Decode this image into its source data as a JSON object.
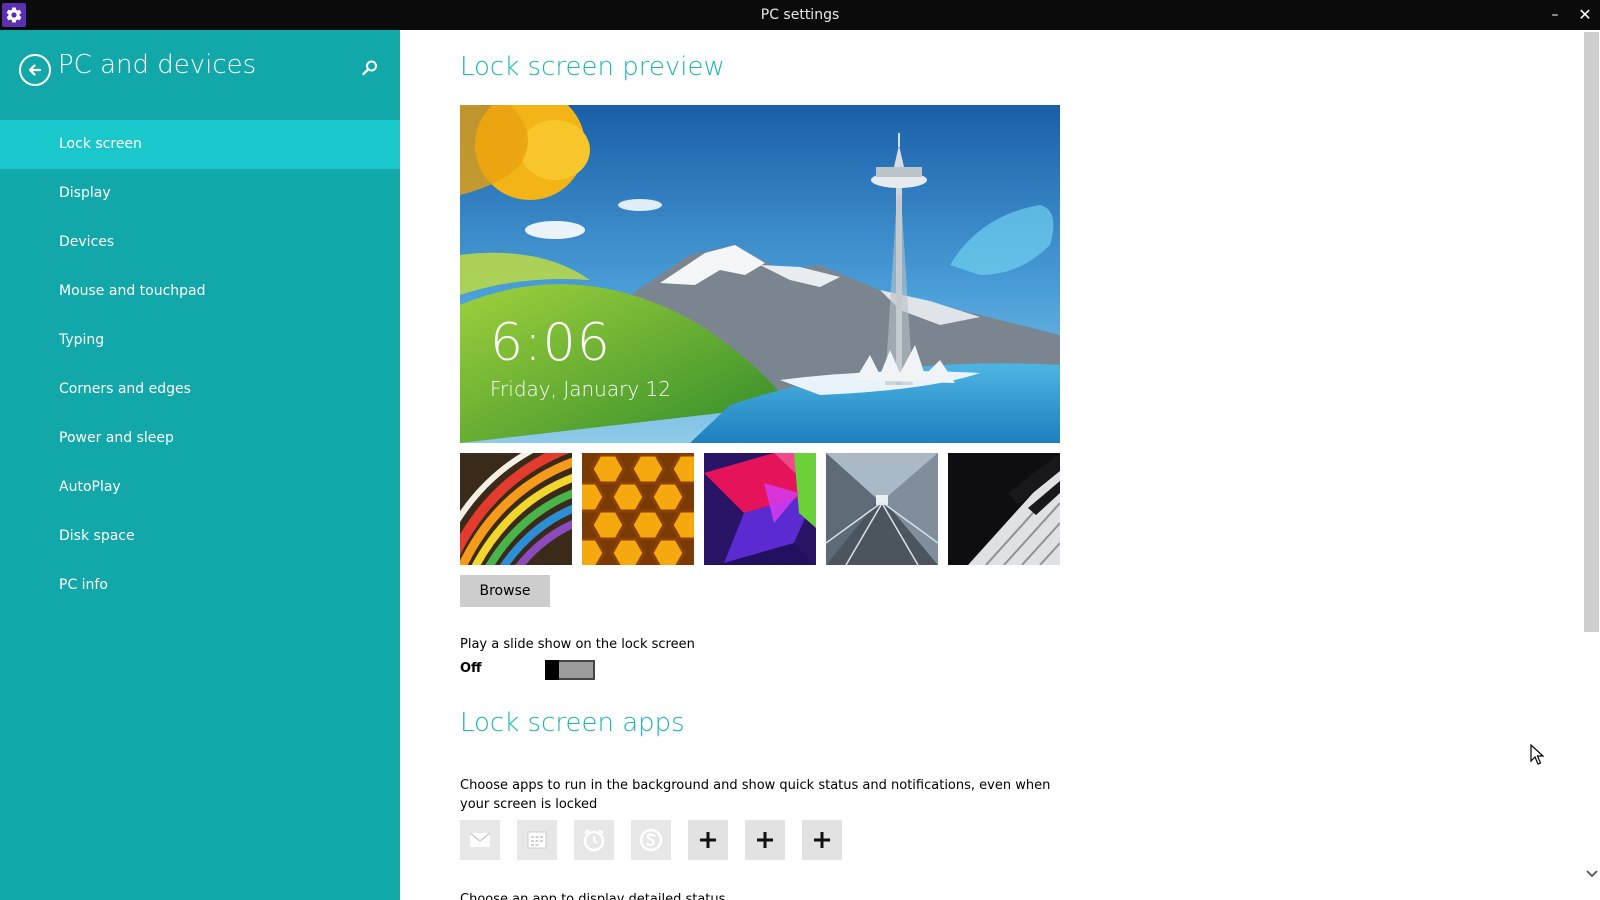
{
  "window": {
    "title": "PC settings",
    "minimize_glyph": "–",
    "close_glyph": "✕",
    "app_icon": "gear-icon"
  },
  "sidebar": {
    "title": "PC and devices",
    "back_icon": "back-arrow-icon",
    "search_icon": "search-icon",
    "items": [
      {
        "label": "Lock screen",
        "active": true
      },
      {
        "label": "Display"
      },
      {
        "label": "Devices"
      },
      {
        "label": "Mouse and touchpad"
      },
      {
        "label": "Typing"
      },
      {
        "label": "Corners and edges"
      },
      {
        "label": "Power and sleep"
      },
      {
        "label": "AutoPlay"
      },
      {
        "label": "Disk space"
      },
      {
        "label": "PC info"
      }
    ]
  },
  "main": {
    "preview_title": "Lock screen preview",
    "preview": {
      "time": "6:06",
      "date": "Friday, January 12"
    },
    "thumbnails": [
      "rainbow-stripes-thumbnail",
      "honeycomb-thumbnail",
      "geometric-prism-thumbnail",
      "train-tunnel-thumbnail",
      "piano-keys-thumbnail"
    ],
    "browse_label": "Browse",
    "slideshow_label": "Play a slide show on the lock screen",
    "slideshow_state": "Off",
    "apps_title": "Lock screen apps",
    "apps_description": "Choose apps to run in the background and show quick status and notifications, even when your screen is locked",
    "app_slots": [
      "mail-icon",
      "calendar-icon",
      "alarm-icon",
      "skype-icon",
      "add-icon",
      "add-icon",
      "add-icon"
    ],
    "cutoff_text": "Choose an app to display detailed status"
  },
  "colors": {
    "sidebar_bg": "#12a7a8",
    "sidebar_active": "#1ac8cc",
    "accent_text": "#1ab5b6",
    "titlebar_bg": "#0b0b0b"
  }
}
